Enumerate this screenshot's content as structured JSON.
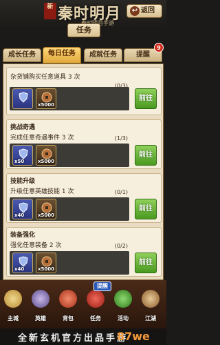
{
  "header": {
    "logo_seal": "新",
    "logo_title": "秦时明月",
    "logo_sub": "秦时明月手游",
    "title": "任务",
    "back_label": "返回"
  },
  "tabs": [
    {
      "label": "成长任务",
      "active": false
    },
    {
      "label": "每日任务",
      "active": true
    },
    {
      "label": "成就任务",
      "active": false
    },
    {
      "label": "提醒",
      "active": false
    }
  ],
  "tab_badge": "9",
  "tasks": [
    {
      "category": "",
      "description": "杂货铺购买任意道具 3 次",
      "progress": "(0/3)",
      "button": "前往",
      "rewards": [
        {
          "icon": "shield-icon",
          "amount": ""
        },
        {
          "icon": "coin-icon",
          "amount": "x5000"
        }
      ]
    },
    {
      "category": "挑战奇遇",
      "description": "完成任意奇遇事件 3 次",
      "progress": "(1/3)",
      "button": "前往",
      "rewards": [
        {
          "icon": "shield-icon",
          "amount": "x50"
        },
        {
          "icon": "coin-icon",
          "amount": "x5000"
        }
      ]
    },
    {
      "category": "技能升级",
      "description": "升级任意英雄技能 1 次",
      "progress": "(0/1)",
      "button": "前往",
      "rewards": [
        {
          "icon": "shield-icon",
          "amount": "x40"
        },
        {
          "icon": "coin-icon",
          "amount": "x5000"
        }
      ]
    },
    {
      "category": "装备强化",
      "description": "强化任意装备 2 次",
      "progress": "(0/2)",
      "button": "前往",
      "rewards": [
        {
          "icon": "shield-icon",
          "amount": "x40"
        },
        {
          "icon": "coin-icon",
          "amount": "x5000"
        }
      ]
    }
  ],
  "bottom_nav": [
    {
      "label": "主城",
      "icon": "city-icon"
    },
    {
      "label": "英雄",
      "icon": "hero-icon"
    },
    {
      "label": "背包",
      "icon": "bag-icon"
    },
    {
      "label": "任务",
      "icon": "task-icon"
    },
    {
      "label": "活动",
      "icon": "activity-icon"
    },
    {
      "label": "江湖",
      "icon": "jianghu-icon"
    }
  ],
  "tip_label": "提醒",
  "footer_text": "全新玄机官方出品手游",
  "watermark": "87we",
  "colors": {
    "accent": "#e0a83a",
    "go_button": "#4a9a20",
    "badge": "#d22a1a"
  }
}
